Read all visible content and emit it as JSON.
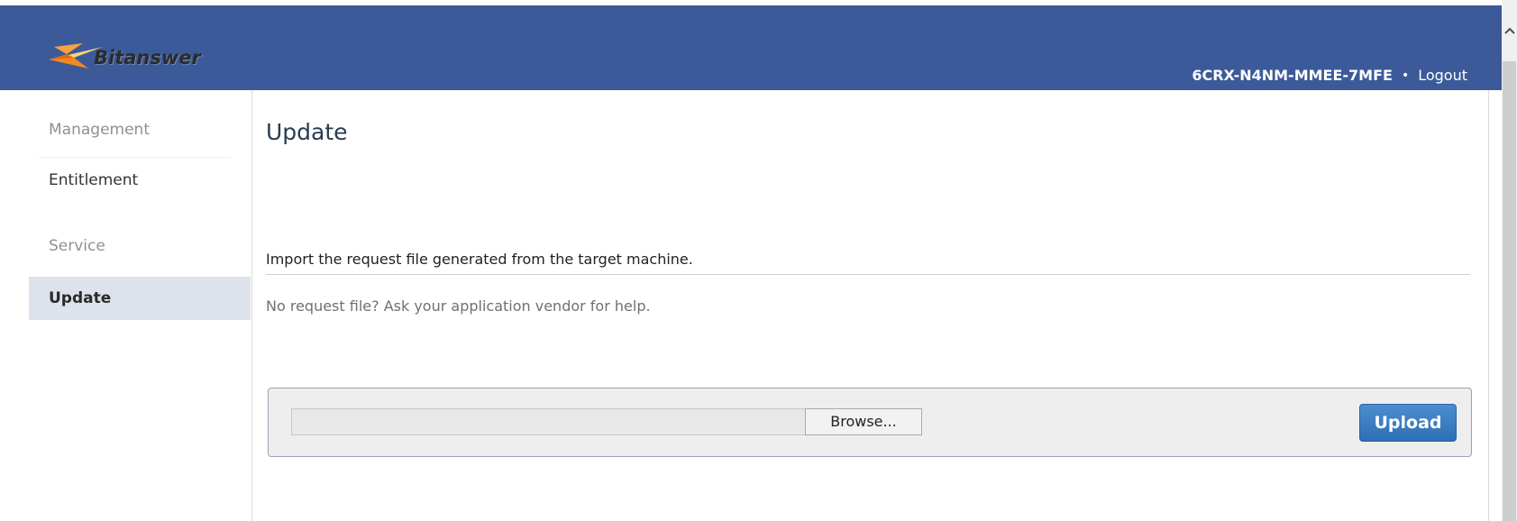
{
  "header": {
    "logo_text": "Bitanswer",
    "license_key": "6CRX-N4NM-MMEE-7MFE",
    "separator": "•",
    "logout_label": "Logout"
  },
  "sidebar": {
    "items": [
      {
        "label": "Management",
        "kind": "group"
      },
      {
        "label": "Entitlement",
        "kind": "link"
      },
      {
        "label": "Service",
        "kind": "group"
      },
      {
        "label": "Update",
        "kind": "active"
      }
    ]
  },
  "main": {
    "title": "Update",
    "import_text": "Import the request file generated from the target machine.",
    "help_text": "No request file? Ask your application vendor for help.",
    "file_path_value": "",
    "browse_label": "Browse...",
    "upload_label": "Upload"
  },
  "colors": {
    "header_bg": "#3c5a9a",
    "active_item_bg": "#dde2ec",
    "upload_button": "#2f6fb3",
    "logo_orange": "#f28a1c"
  },
  "icons": {
    "logo_mark": "bitanswer-logo-icon",
    "scroll_up": "chevron-up-icon"
  }
}
